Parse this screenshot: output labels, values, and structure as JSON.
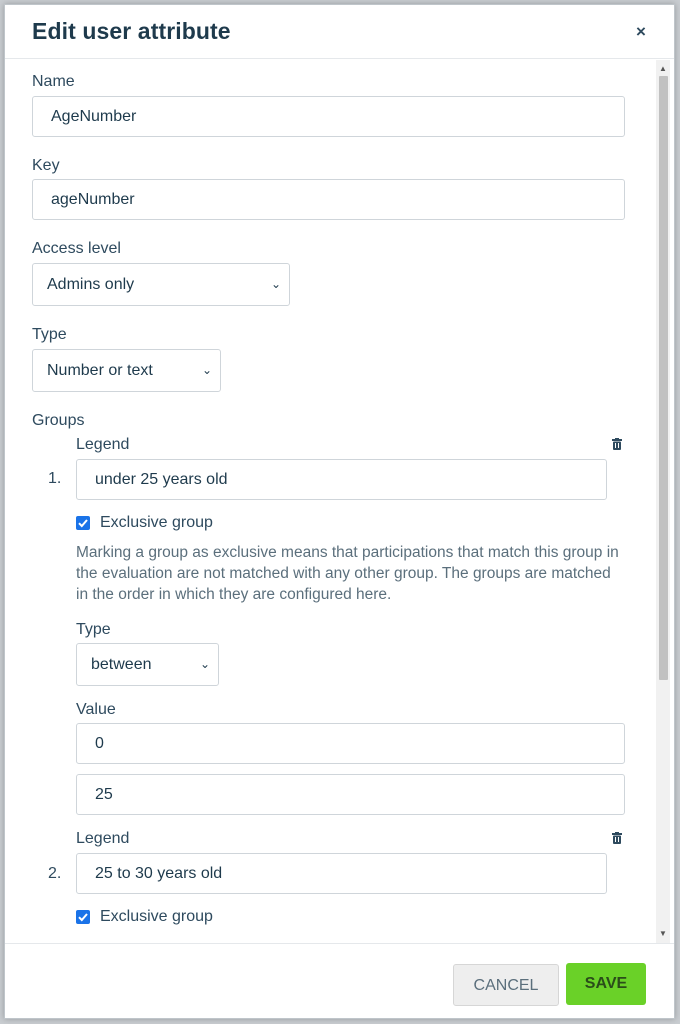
{
  "dialog": {
    "title": "Edit user attribute",
    "close_label": "×"
  },
  "form": {
    "name_label": "Name",
    "name_value": "AgeNumber",
    "key_label": "Key",
    "key_value": "ageNumber",
    "access_label": "Access level",
    "access_value": "Admins only",
    "type_label": "Type",
    "type_value": "Number or text",
    "groups_label": "Groups"
  },
  "groups": [
    {
      "index": "1.",
      "legend_label": "Legend",
      "legend_value": "under 25 years old",
      "exclusive_label": "Exclusive group",
      "exclusive_checked": true,
      "helper_text": "Marking a group as exclusive means that participations that match this group in the evaluation are not matched with any other group. The groups are matched in the order in which they are configured here.",
      "type_label": "Type",
      "type_value": "between",
      "value_label": "Value",
      "value_from": "0",
      "value_to": "25"
    },
    {
      "index": "2.",
      "legend_label": "Legend",
      "legend_value": "25 to 30 years old",
      "exclusive_label": "Exclusive group",
      "exclusive_checked": true
    }
  ],
  "footer": {
    "cancel_label": "CANCEL",
    "save_label": "SAVE"
  },
  "icons": {
    "close": "close-icon",
    "trash": "trash-icon",
    "chevron": "chevron-down-icon",
    "check": "check-icon"
  },
  "colors": {
    "title": "#1e3a4c",
    "text": "#2e4a5e",
    "save_button": "#6ad128",
    "checkbox": "#1a73e8",
    "cancel_button": "#eeeeee"
  }
}
